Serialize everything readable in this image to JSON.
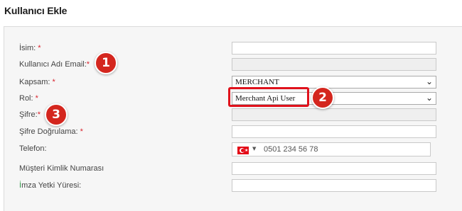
{
  "page": {
    "title": "Kullanıcı Ekle"
  },
  "form": {
    "isim_label": "İsim:",
    "email_label": "Kullanıcı Adı Email:",
    "kapsam_label": "Kapsam:",
    "kapsam_value": "MERCHANT",
    "rol_label": "Rol:",
    "rol_value": "Merchant Api User",
    "sifre_label": "Şifre:",
    "sifre_dogrulama_label": "Şifre Doğrulama:",
    "telefon_label": "Telefon:",
    "telefon_placeholder": "0501 234 56 78",
    "musteri_label": "Müşteri Kimlik Numarası",
    "imza_label_prefix": "İ",
    "imza_label_rest": "mza Yetki Yüresi:",
    "required_mark": "*"
  },
  "annotations": {
    "badge1": "1",
    "badge2": "2",
    "badge3": "3"
  },
  "colors": {
    "required": "#d9232d",
    "badge": "#d4261e",
    "highlight": "#e0121c"
  },
  "icons": {
    "country_flag": "turkey-flag-icon",
    "dropdown": "chevron-down-icon"
  }
}
